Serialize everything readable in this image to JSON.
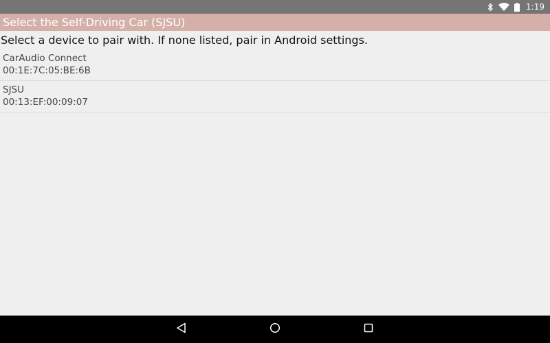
{
  "status_bar": {
    "time": "1:19",
    "icons": [
      "bluetooth-icon",
      "wifi-icon",
      "battery-icon"
    ]
  },
  "title_bar": {
    "title": "Select the Self-Driving Car (SJSU)"
  },
  "instructions": {
    "text": "Select a device to pair with. If none listed, pair in Android settings."
  },
  "devices": [
    {
      "name": "CarAudio Connect",
      "address": "00:1E:7C:05:BE:6B"
    },
    {
      "name": "SJSU",
      "address": "00:13:EF:00:09:07"
    }
  ],
  "nav_bar": {
    "buttons": [
      "back-icon",
      "home-icon",
      "recents-icon"
    ]
  },
  "colors": {
    "title_bar_bg": "#d4b0a8",
    "status_bar_bg": "#757575",
    "background": "#efefef",
    "nav_bar_bg": "#000000"
  }
}
